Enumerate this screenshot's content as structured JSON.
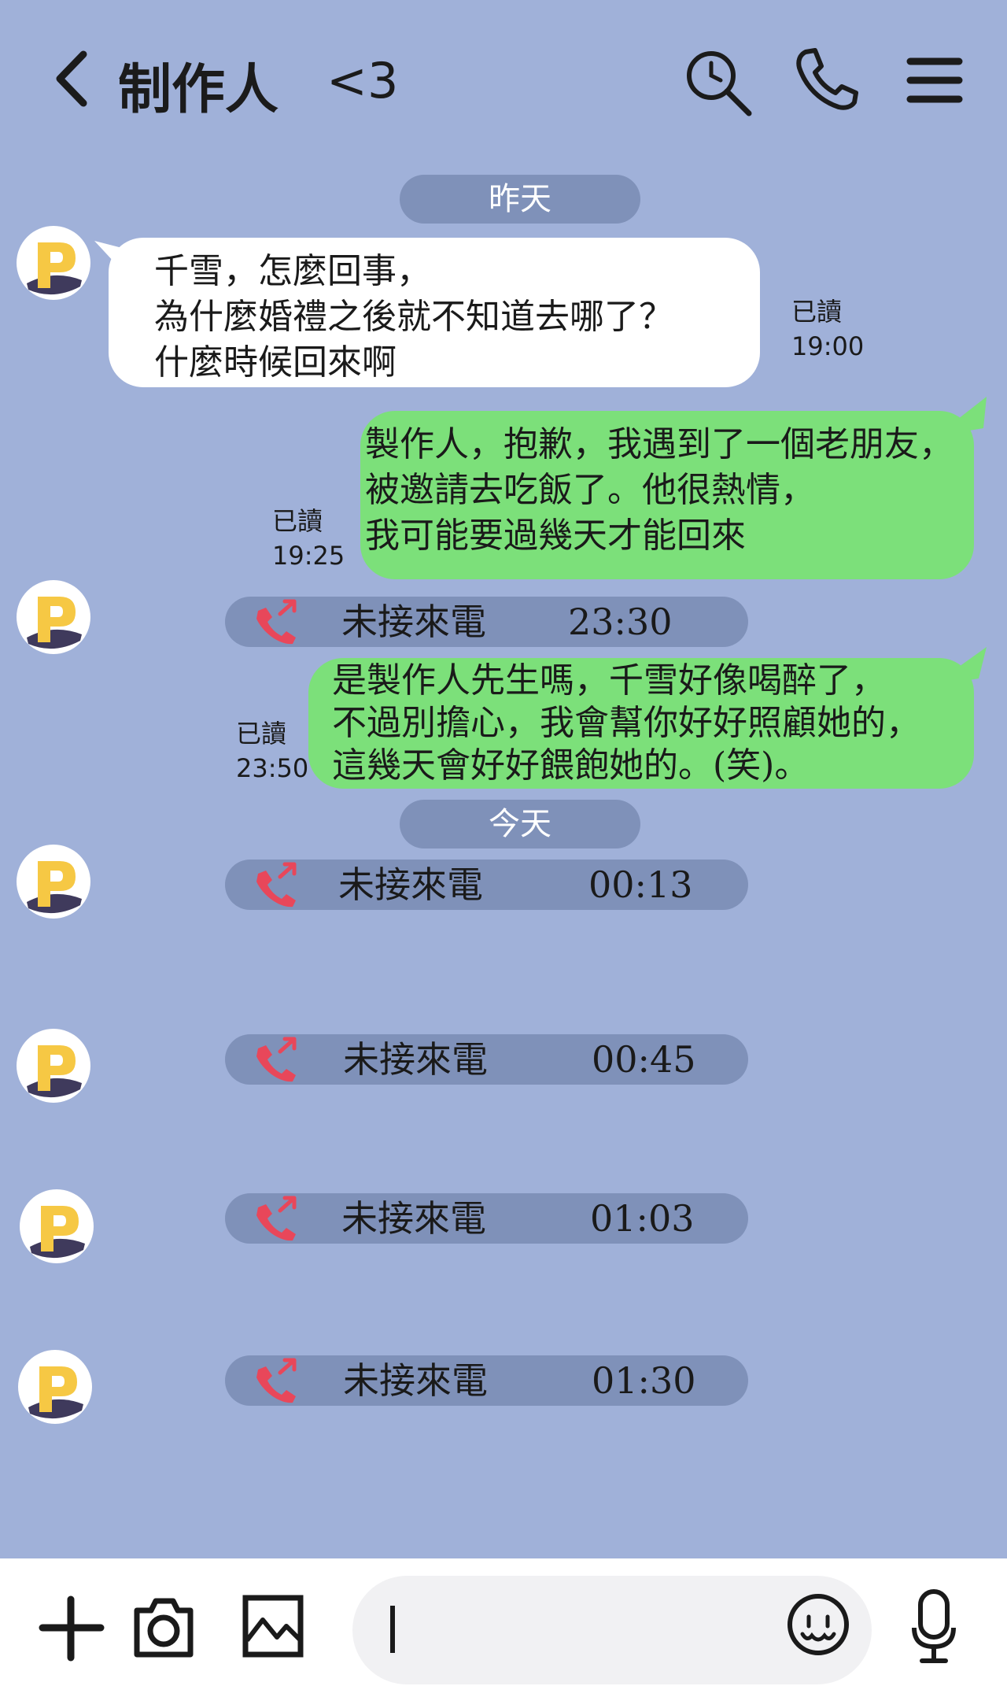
{
  "header": {
    "title": "制作人",
    "title_suffix": "<3",
    "icons": [
      "back-arrow-icon",
      "search-icon",
      "phone-icon",
      "menu-icon"
    ]
  },
  "dates": {
    "yesterday": "昨天",
    "today": "今天"
  },
  "messages": [
    {
      "direction": "incoming",
      "lines": [
        "千雪，怎麼回事，",
        "為什麼婚禮之後就不知道去哪了？",
        "什麼時候回來啊"
      ],
      "read_label": "已讀",
      "time": "19:00"
    },
    {
      "direction": "outgoing",
      "lines": [
        "製作人，抱歉，我遇到了一個老朋友，",
        "被邀請去吃飯了。他很熱情，",
        "我可能要過幾天才能回來"
      ],
      "read_label": "已讀",
      "time": "19:25"
    },
    {
      "direction": "outgoing",
      "lines": [
        "是製作人先生嗎，千雪好像喝醉了，",
        "不過別擔心，我會幫你好好照顧她的，",
        "這幾天會好好餵飽她的。(笑)。"
      ],
      "read_label": "已讀",
      "time": "23:50"
    }
  ],
  "missed_calls": [
    {
      "label": "未接來電",
      "time": "23:30"
    },
    {
      "label": "未接來電",
      "time": "00:13"
    },
    {
      "label": "未接來電",
      "time": "00:45"
    },
    {
      "label": "未接來電",
      "time": "01:03"
    },
    {
      "label": "未接來電",
      "time": "01:30"
    }
  ],
  "colors": {
    "background": "#a0b1d9",
    "pill": "#7f91b9",
    "incoming_bubble": "#ffffff",
    "outgoing_bubble": "#7ce07a",
    "missed_call_icon": "#e8475a",
    "avatar_letter": "#f6c844"
  },
  "bottom_bar": {
    "icons": [
      "plus-icon",
      "camera-icon",
      "image-icon",
      "emoji-icon",
      "microphone-icon"
    ],
    "input_value": ""
  }
}
